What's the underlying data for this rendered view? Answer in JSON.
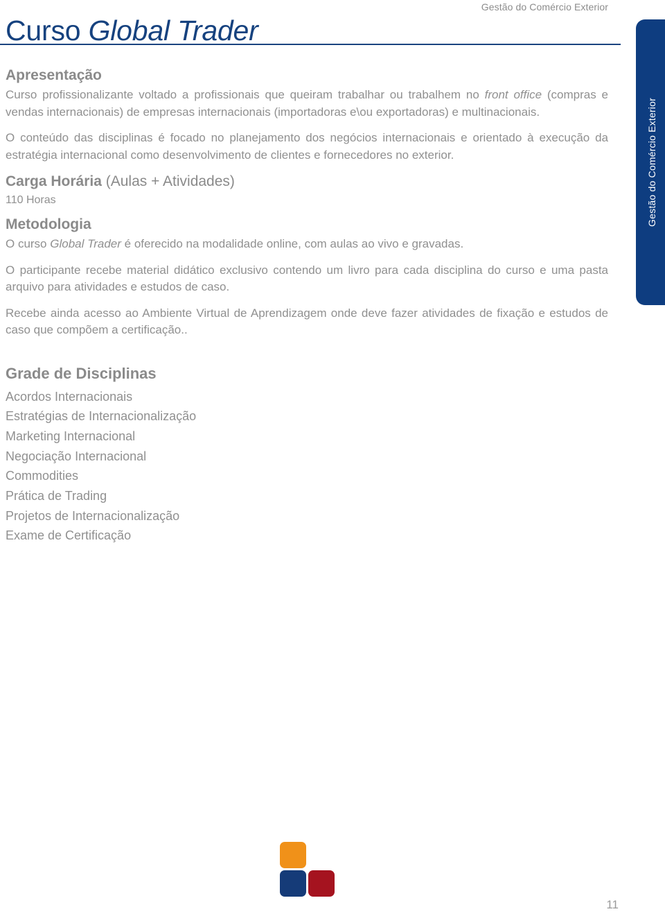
{
  "running_head": "Gestão do Comércio Exterior",
  "title": {
    "prefix": "Curso ",
    "emphasis": "Global Trader"
  },
  "side_tab": {
    "label": "Gestão do Comércio Exterior",
    "color": "#0e3d80"
  },
  "sections": {
    "apresentacao": {
      "heading": "Apresentação",
      "paragraph_1_part_1": "Curso profissionalizante voltado a profissionais que queiram trabalhar ou trabalhem no ",
      "paragraph_1_emphasis": "front office",
      "paragraph_1_part_2": " (compras e vendas internacionais) de empresas internacionais (importadoras e\\ou exportadoras) e multinacionais.",
      "paragraph_2": "O conteúdo das disciplinas é focado no planejamento dos negócios internacionais e orientado à execução da estratégia internacional como desenvolvimento de clientes e fornecedores no exterior."
    },
    "carga_horaria": {
      "heading_bold": "Carga Horária",
      "heading_light": " (Aulas + Atividades)",
      "value": "110 Horas"
    },
    "metodologia": {
      "heading": "Metodologia",
      "paragraph_1_part_1": "O curso ",
      "paragraph_1_emphasis": "Global Trader",
      "paragraph_1_part_2": " é oferecido na modalidade online, com aulas ao vivo e gravadas.",
      "paragraph_2": "O participante recebe material didático exclusivo contendo um livro para cada disciplina do curso e uma pasta arquivo para atividades e estudos de caso.",
      "paragraph_3": "Recebe ainda acesso ao Ambiente Virtual de Aprendizagem onde deve fazer atividades de fixação e estudos de caso que compõem a certificação.."
    },
    "grade_de_disciplinas": {
      "heading": "Grade de Disciplinas",
      "items": [
        "Acordos Internacionais",
        "Estratégias de Internacionalização",
        "Marketing Internacional",
        "Negociação Internacional",
        "Commodities",
        "Prática de Trading",
        "Projetos de Internacionalização",
        "Exame de Certificação"
      ]
    }
  },
  "logo": {
    "square_orange": "#f09119",
    "square_blue": "#153b78",
    "square_red": "#a5131f"
  },
  "page_number": "11"
}
